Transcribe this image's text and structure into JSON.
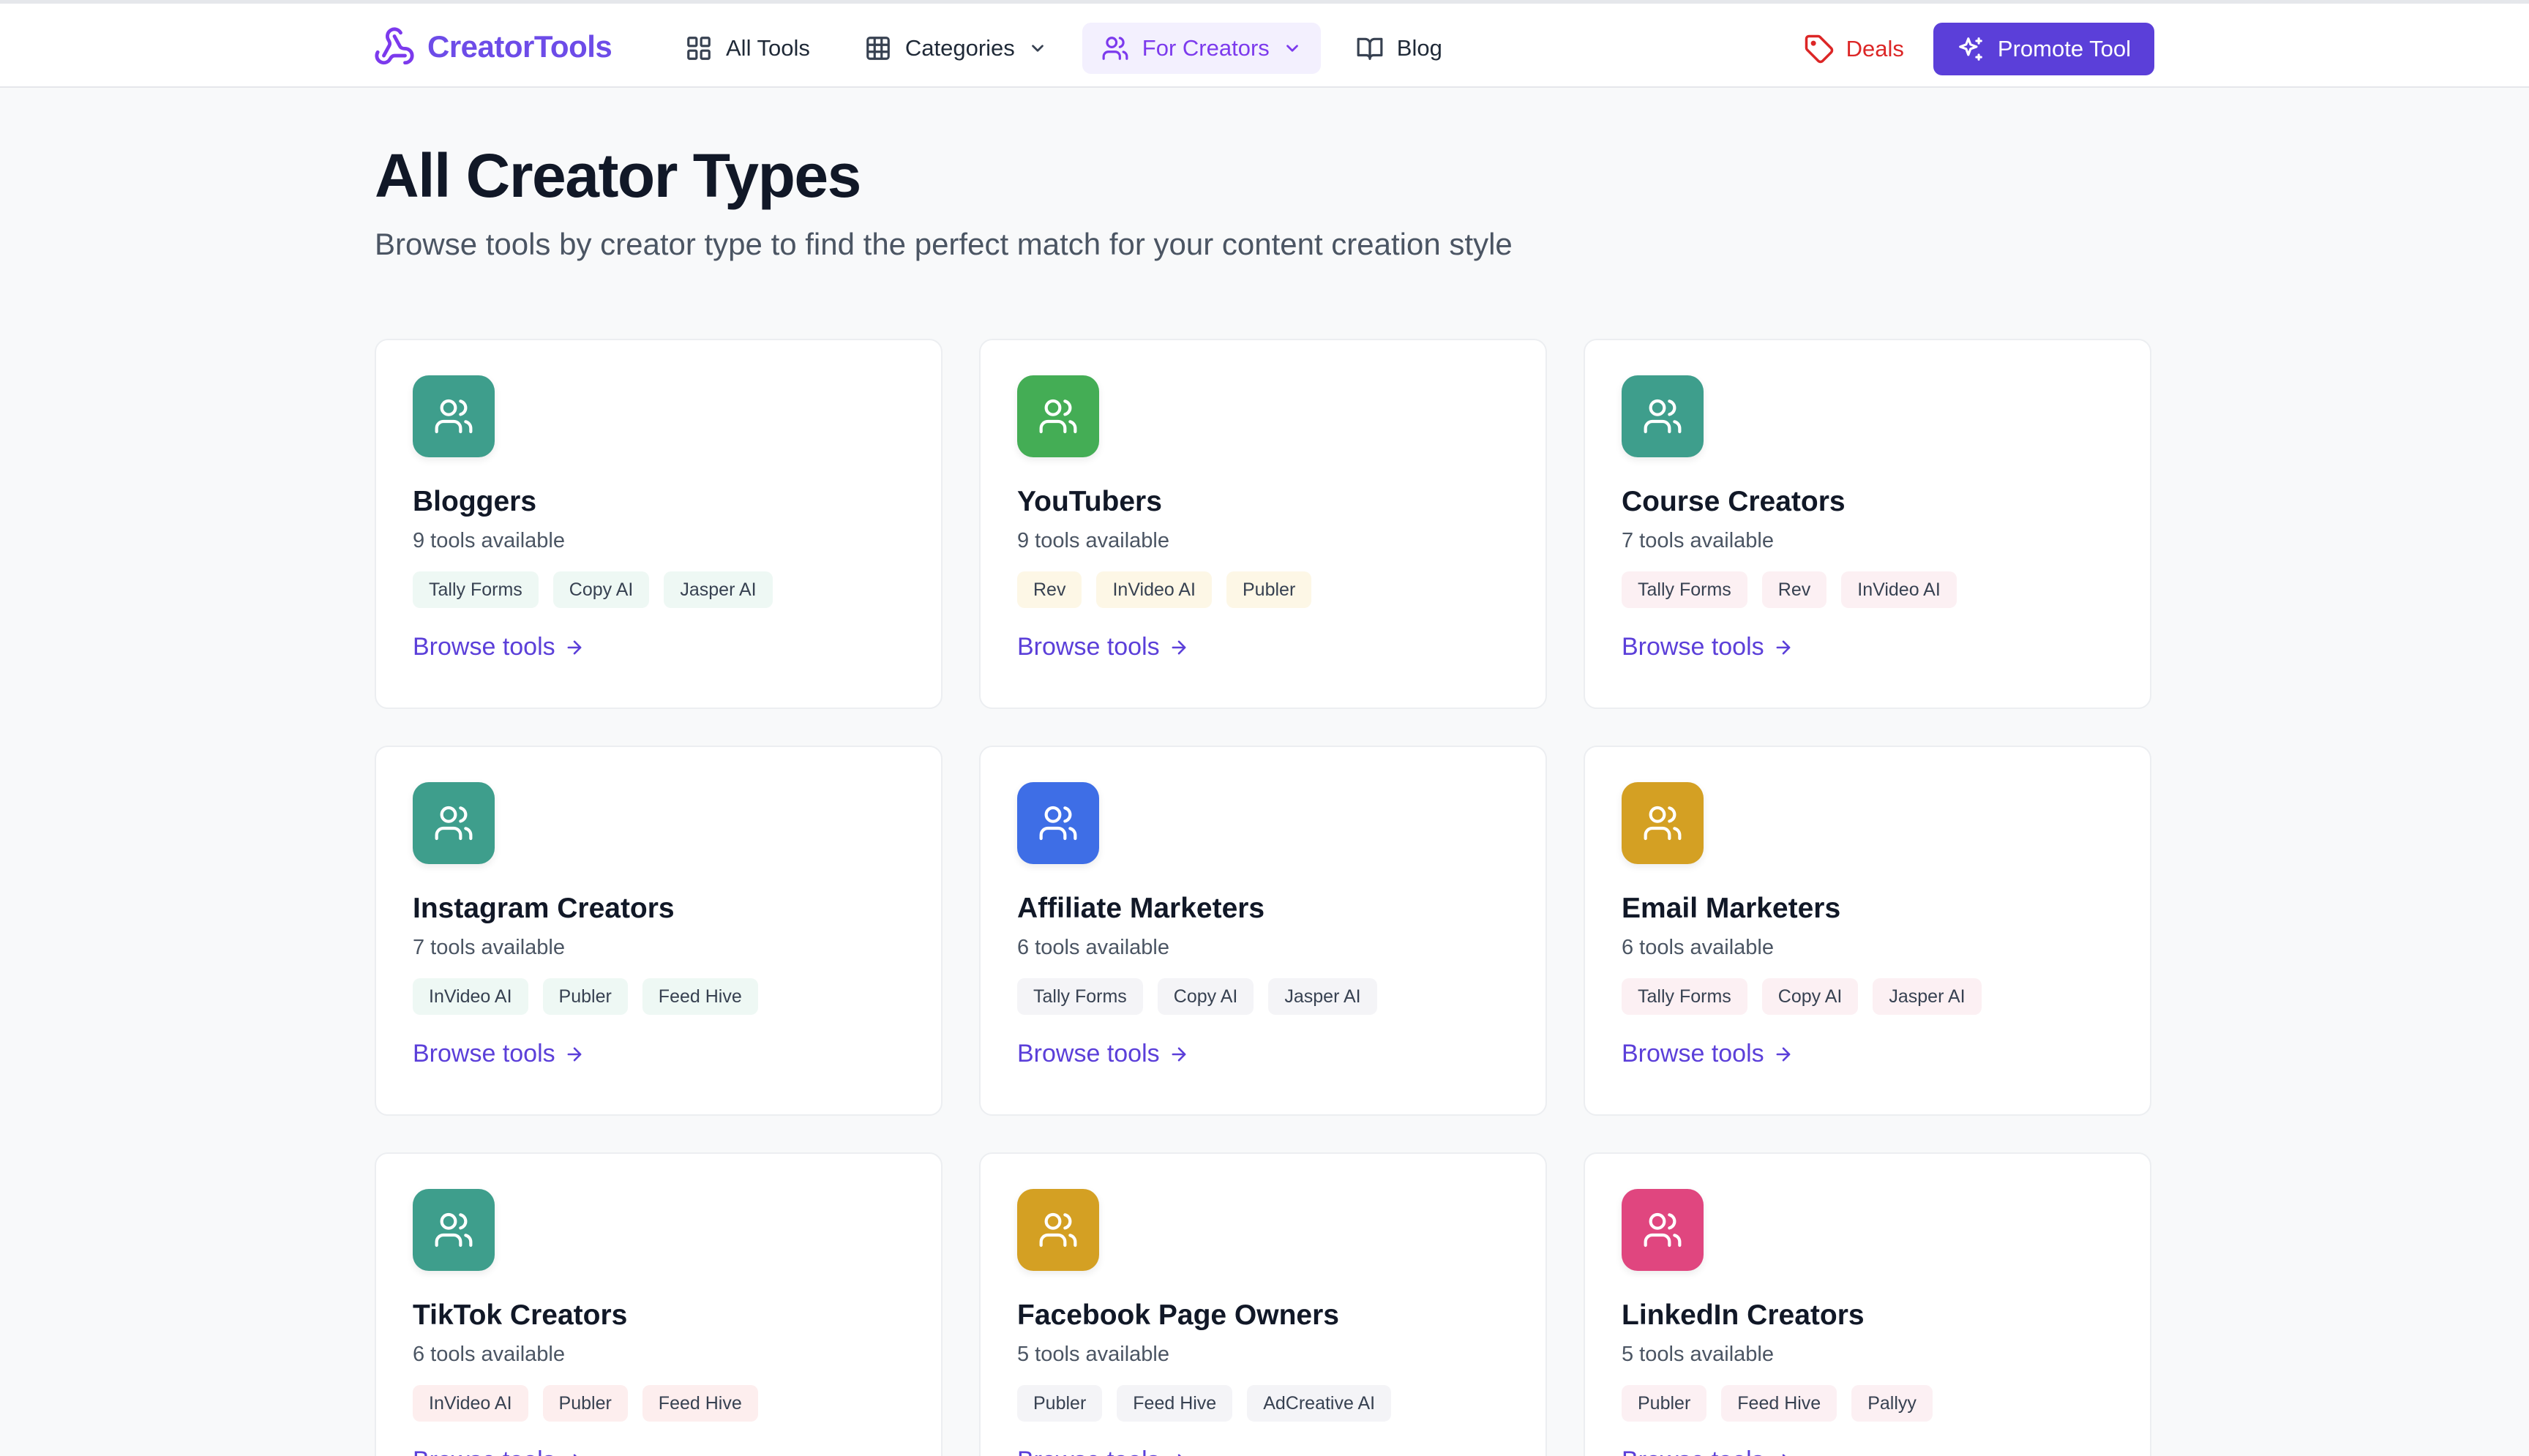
{
  "header": {
    "brand": "CreatorTools",
    "nav": [
      {
        "label": "All Tools",
        "icon": "grid-icon"
      },
      {
        "label": "Categories",
        "icon": "table-icon"
      },
      {
        "label": "For Creators",
        "icon": "users-icon"
      },
      {
        "label": "Blog",
        "icon": "book-icon"
      }
    ],
    "deals_label": "Deals",
    "promote_label": "Promote Tool"
  },
  "page": {
    "title": "All Creator Types",
    "subtitle": "Browse tools by creator type to find the perfect match for your content creation style"
  },
  "colors": {
    "brand": "#6d4ce8",
    "accent": "#5b3fd9",
    "deals": "#dc2626"
  },
  "cards": [
    {
      "title": "Bloggers",
      "count": "9 tools available",
      "icon_color": "#3e9e8c",
      "tag_bg": "#eef8f4",
      "tags": [
        "Tally Forms",
        "Copy AI",
        "Jasper AI"
      ],
      "link": "Browse tools"
    },
    {
      "title": "YouTubers",
      "count": "9 tools available",
      "icon_color": "#44ad55",
      "tag_bg": "#fdf7e6",
      "tags": [
        "Rev",
        "InVideo AI",
        "Publer"
      ],
      "link": "Browse tools"
    },
    {
      "title": "Course Creators",
      "count": "7 tools available",
      "icon_color": "#3e9e8c",
      "tag_bg": "#fcf0f3",
      "tags": [
        "Tally Forms",
        "Rev",
        "InVideo AI"
      ],
      "link": "Browse tools"
    },
    {
      "title": "Instagram Creators",
      "count": "7 tools available",
      "icon_color": "#3e9e8c",
      "tag_bg": "#eef8f4",
      "tags": [
        "InVideo AI",
        "Publer",
        "Feed Hive"
      ],
      "link": "Browse tools"
    },
    {
      "title": "Affiliate Marketers",
      "count": "6 tools available",
      "icon_color": "#3e6ee6",
      "tag_bg": "#f4f4f7",
      "tags": [
        "Tally Forms",
        "Copy AI",
        "Jasper AI"
      ],
      "link": "Browse tools"
    },
    {
      "title": "Email Marketers",
      "count": "6 tools available",
      "icon_color": "#d4a023",
      "tag_bg": "#fcf0f3",
      "tags": [
        "Tally Forms",
        "Copy AI",
        "Jasper AI"
      ],
      "link": "Browse tools"
    },
    {
      "title": "TikTok Creators",
      "count": "6 tools available",
      "icon_color": "#3e9e8c",
      "tag_bg": "#fdeeee",
      "tags": [
        "InVideo AI",
        "Publer",
        "Feed Hive"
      ],
      "link": "Browse tools"
    },
    {
      "title": "Facebook Page Owners",
      "count": "5 tools available",
      "icon_color": "#d4a023",
      "tag_bg": "#f4f4f7",
      "tags": [
        "Publer",
        "Feed Hive",
        "AdCreative AI"
      ],
      "link": "Browse tools"
    },
    {
      "title": "LinkedIn Creators",
      "count": "5 tools available",
      "icon_color": "#e0467f",
      "tag_bg": "#fcf0f3",
      "tags": [
        "Publer",
        "Feed Hive",
        "Pallyy"
      ],
      "link": "Browse tools"
    }
  ]
}
